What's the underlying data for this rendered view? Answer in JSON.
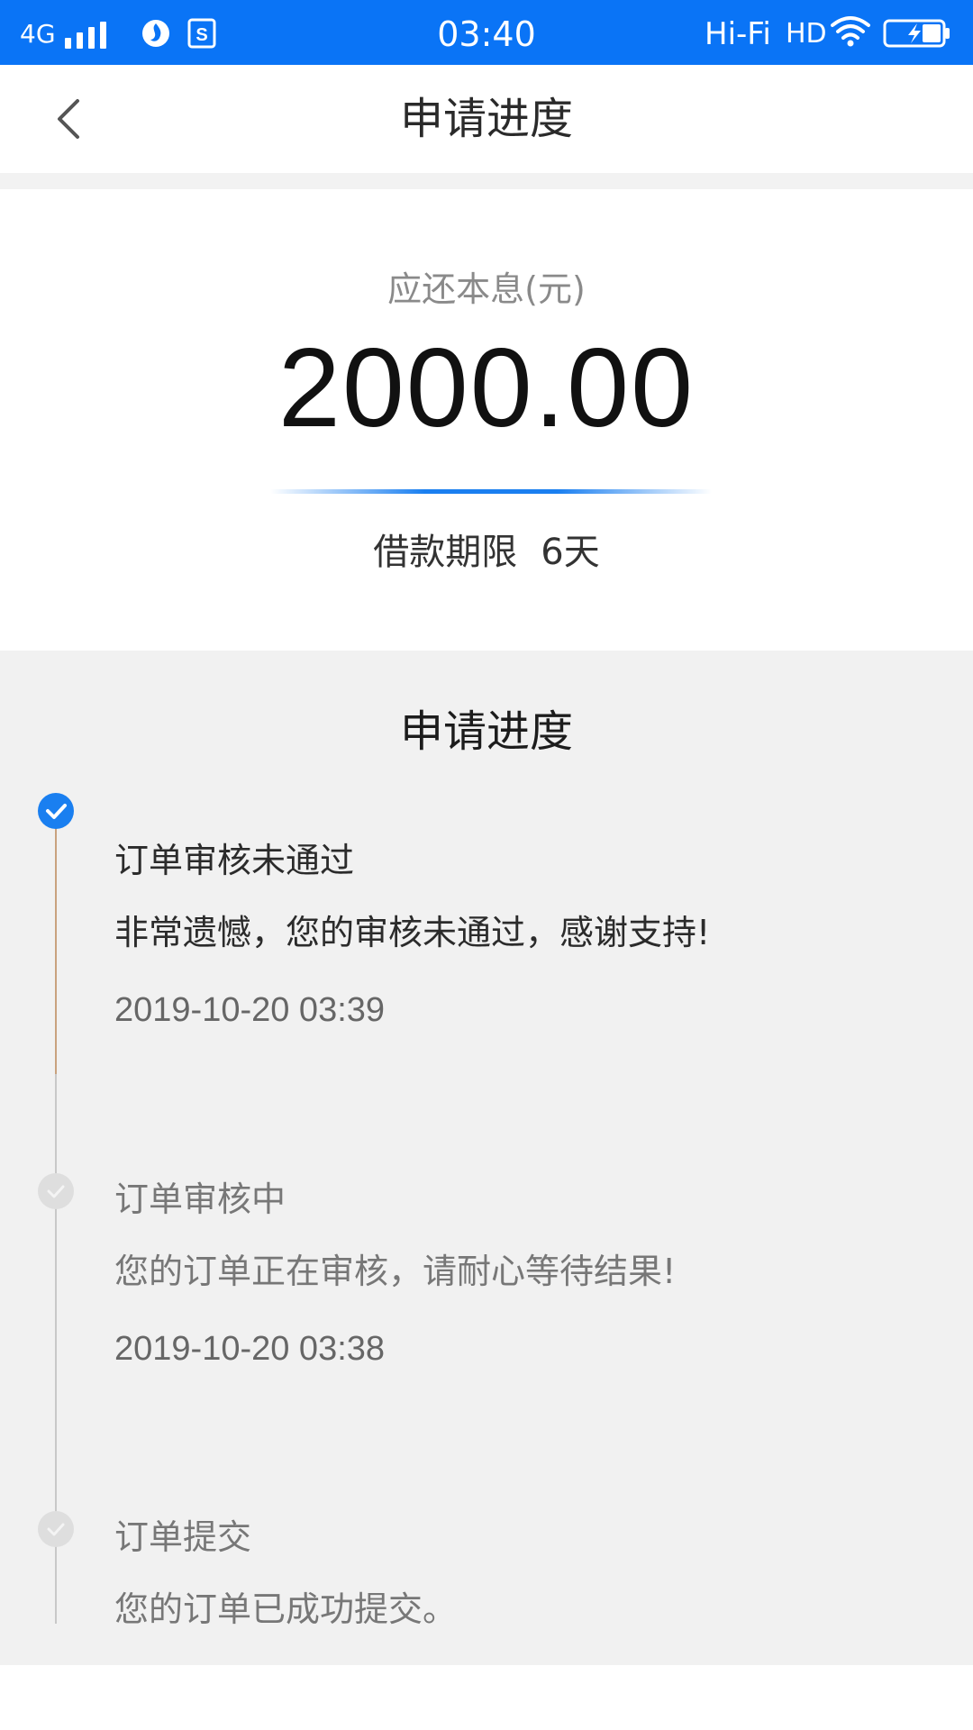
{
  "status_bar": {
    "network": "4G",
    "time": "03:40",
    "hifi": "Hi-Fi",
    "hd": "HD",
    "background_color": "#0a74f6"
  },
  "header": {
    "title": "申请进度",
    "back_icon": "chevron-left-icon"
  },
  "summary": {
    "amount_label": "应还本息(元)",
    "amount": "2000.00",
    "term_label": "借款期限",
    "term_value": "6天"
  },
  "progress": {
    "title": "申请进度",
    "accent_color": "#1a7ff0",
    "steps": [
      {
        "title": "订单审核未通过",
        "description": "非常遗憾，您的审核未通过，感谢支持!",
        "time": "2019-10-20 03:39",
        "status": "completed",
        "icon": "check-circle-icon"
      },
      {
        "title": "订单审核中",
        "description": "您的订单正在审核，请耐心等待结果!",
        "time": "2019-10-20 03:38",
        "status": "inactive",
        "icon": "check-circle-icon"
      },
      {
        "title": "订单提交",
        "description": "您的订单已成功提交。",
        "status": "inactive",
        "icon": "check-circle-icon"
      }
    ]
  }
}
